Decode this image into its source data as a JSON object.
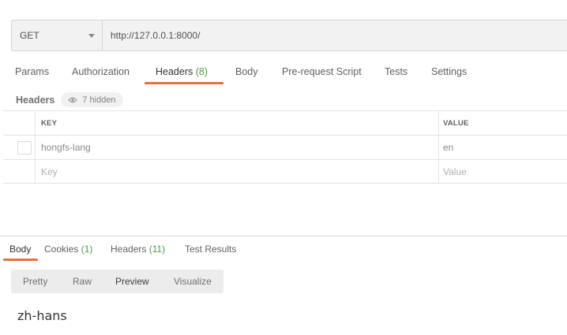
{
  "request": {
    "method": "GET",
    "url": "http://127.0.0.1:8000/"
  },
  "req_tabs": {
    "params": "Params",
    "authorization": "Authorization",
    "headers": "Headers",
    "headers_count": "(8)",
    "body": "Body",
    "prerequest": "Pre-request Script",
    "tests": "Tests",
    "settings": "Settings"
  },
  "headers_section": {
    "title": "Headers",
    "hidden": "7 hidden",
    "columns": {
      "key": "KEY",
      "value": "VALUE"
    },
    "rows": [
      {
        "key": "hongfs-lang",
        "value": "en"
      }
    ],
    "placeholder": {
      "key": "Key",
      "value": "Value"
    }
  },
  "response": {
    "tabs": {
      "body": "Body",
      "cookies": "Cookies",
      "cookies_count": "(1)",
      "headers": "Headers",
      "headers_count": "(11)",
      "test_results": "Test Results"
    },
    "views": {
      "pretty": "Pretty",
      "raw": "Raw",
      "preview": "Preview",
      "visualize": "Visualize"
    },
    "body_text": "zh-hans"
  },
  "colors": {
    "accent": "#e8703a",
    "count": "#4a9e4a"
  }
}
